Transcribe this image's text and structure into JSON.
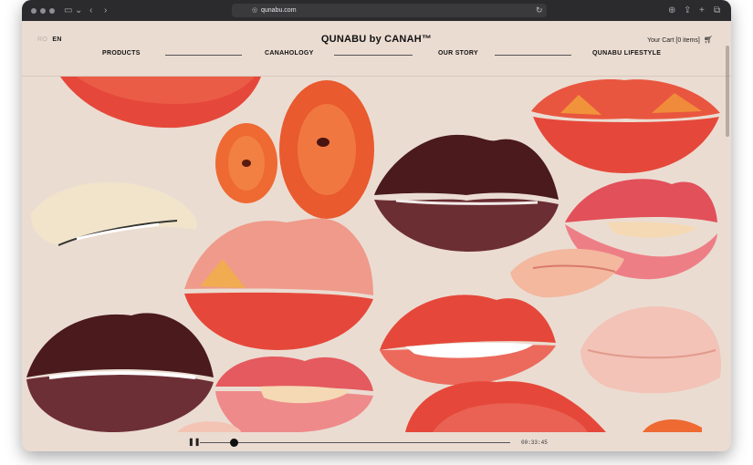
{
  "browser": {
    "url": "qunabu.com",
    "icons": [
      "sidebar-icon",
      "back-icon",
      "forward-icon",
      "shield-icon",
      "lock-icon",
      "reload-icon",
      "download-icon",
      "share-icon",
      "new-tab-icon",
      "tabs-overview-icon"
    ]
  },
  "header": {
    "lang_ro": "RO",
    "lang_en": "EN",
    "brand": "QUNABU by CANAH™",
    "cart_label": "Your Cart [0 items]",
    "nav": [
      "PRODUCTS",
      "CANAHOLOGY",
      "OUR STORY",
      "QUNABU LIFESTYLE"
    ]
  },
  "player": {
    "time": "00:33:45",
    "progress": 0.11
  },
  "colors": {
    "background": "#ebdcd2",
    "lip_red": "#e5483a",
    "lip_dark": "#4a1a1c",
    "lip_pink": "#ef9a8a",
    "lip_orange": "#ee6a32"
  }
}
